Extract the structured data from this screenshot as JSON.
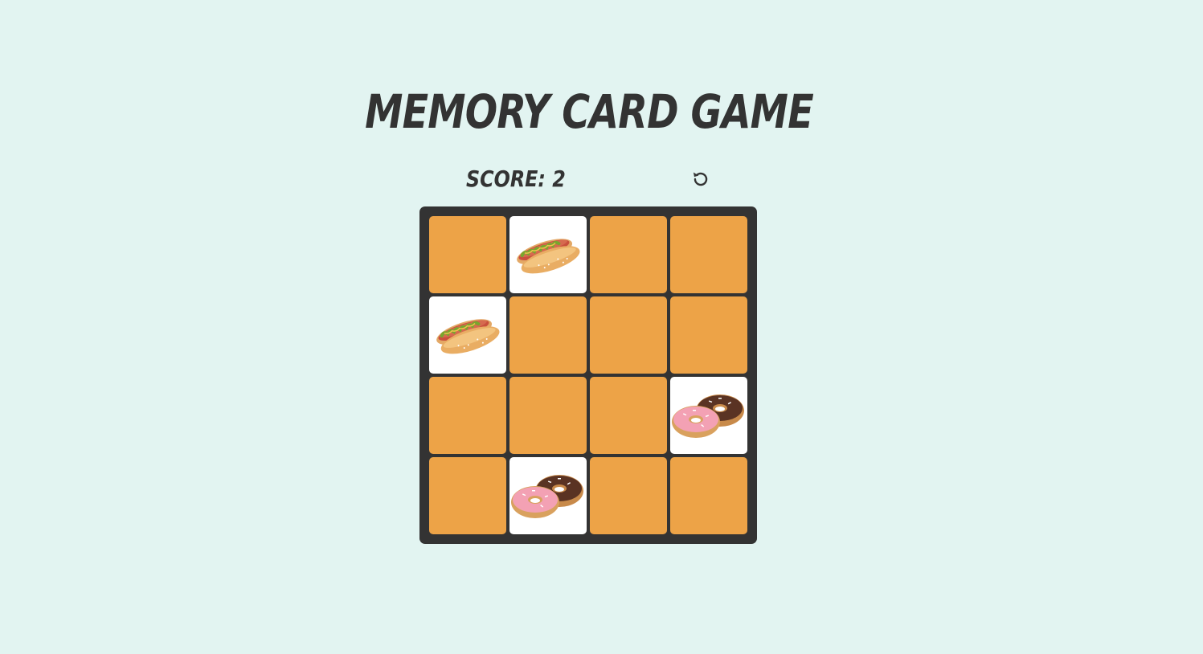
{
  "game": {
    "title": "MEMORY CARD GAME",
    "score_label": "SCORE: 2",
    "score": 2,
    "reset_icon": "reset-icon"
  },
  "colors": {
    "background": "#e2f4f1",
    "board": "#333333",
    "card_back": "#eda347",
    "card_face": "#ffffff",
    "text": "#333333"
  },
  "board": {
    "rows": 4,
    "columns": 4,
    "cards": [
      {
        "state": "hidden",
        "item": null
      },
      {
        "state": "revealed",
        "item": "hotdog-icon"
      },
      {
        "state": "hidden",
        "item": null
      },
      {
        "state": "hidden",
        "item": null
      },
      {
        "state": "revealed",
        "item": "hotdog-icon"
      },
      {
        "state": "hidden",
        "item": null
      },
      {
        "state": "hidden",
        "item": null
      },
      {
        "state": "hidden",
        "item": null
      },
      {
        "state": "hidden",
        "item": null
      },
      {
        "state": "hidden",
        "item": null
      },
      {
        "state": "hidden",
        "item": null
      },
      {
        "state": "revealed",
        "item": "donuts-icon"
      },
      {
        "state": "hidden",
        "item": null
      },
      {
        "state": "revealed",
        "item": "donuts-icon"
      },
      {
        "state": "hidden",
        "item": null
      },
      {
        "state": "hidden",
        "item": null
      }
    ]
  }
}
